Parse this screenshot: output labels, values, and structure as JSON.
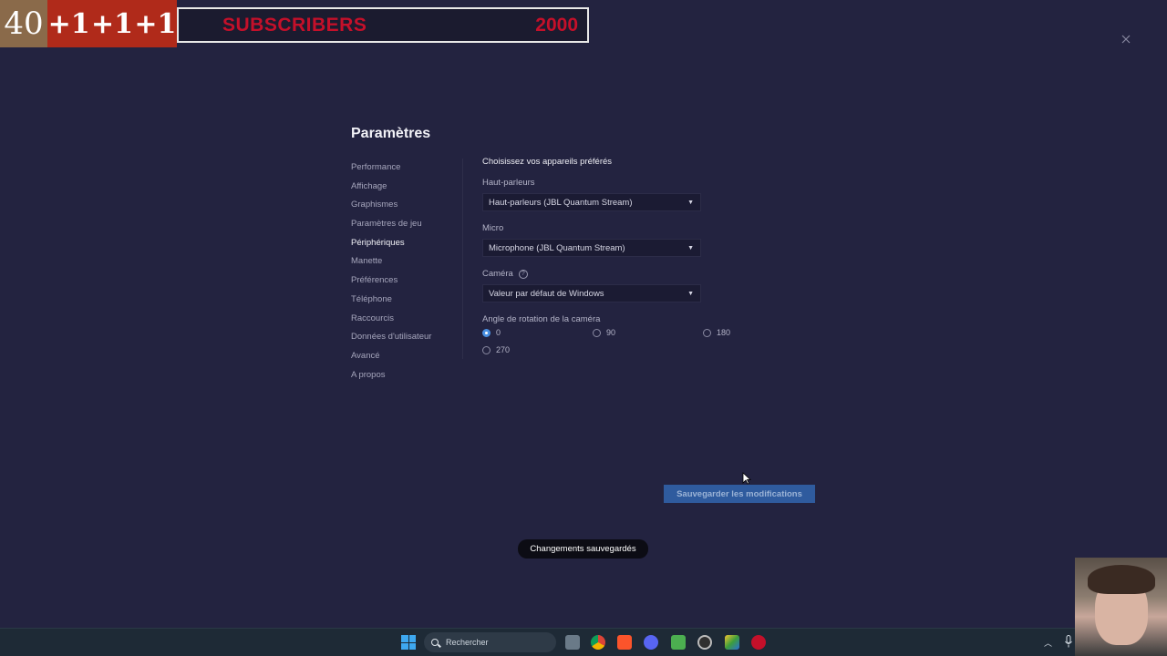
{
  "overlay": {
    "count": "40",
    "plus_items": [
      "+1",
      "+1",
      "+1"
    ],
    "label": "SUBSCRIBERS",
    "goal": "2000"
  },
  "settings": {
    "title": "Paramètres",
    "nav": [
      {
        "label": "Performance"
      },
      {
        "label": "Affichage"
      },
      {
        "label": "Graphismes"
      },
      {
        "label": "Paramètres de jeu"
      },
      {
        "label": "Périphériques",
        "active": true
      },
      {
        "label": "Manette"
      },
      {
        "label": "Préférences"
      },
      {
        "label": "Téléphone"
      },
      {
        "label": "Raccourcis"
      },
      {
        "label": "Données d'utilisateur"
      },
      {
        "label": "Avancé"
      },
      {
        "label": "A propos"
      }
    ],
    "section_title": "Choisissez vos appareils préférés",
    "speakers": {
      "label": "Haut-parleurs",
      "value": "Haut-parleurs (JBL Quantum Stream)"
    },
    "mic": {
      "label": "Micro",
      "value": "Microphone (JBL Quantum Stream)"
    },
    "camera": {
      "label": "Caméra",
      "value": "Valeur par défaut de Windows",
      "help_icon": "help-icon"
    },
    "rotation": {
      "label": "Angle de rotation de la caméra",
      "options": [
        "0",
        "90",
        "180",
        "270"
      ],
      "selected": "0"
    },
    "save_label": "Sauvegarder les modifications",
    "toast": "Changements sauvegardés"
  },
  "taskbar": {
    "search_placeholder": "Rechercher",
    "icons": [
      "windows-start-icon",
      "search-icon",
      "file-explorer-icon",
      "chrome-icon",
      "brave-icon",
      "discord-icon",
      "bluestacks-icon",
      "obs-icon",
      "bluestacks-player-icon",
      "youtube-icon"
    ]
  },
  "colors": {
    "background": "#232340",
    "accent": "#2f5b9e",
    "overlay_red": "#c4102a"
  }
}
